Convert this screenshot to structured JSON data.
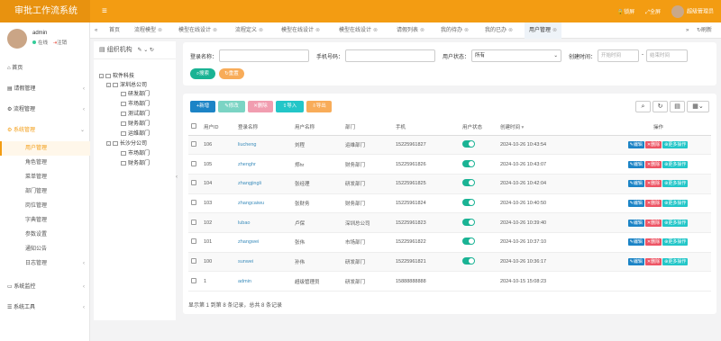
{
  "app": {
    "title": "审批工作流系统",
    "menu_icon": "hamburger-icon"
  },
  "top_right": {
    "lock": "锁屏",
    "fullscreen": "全屏",
    "user": "超级管理员"
  },
  "sidebar": {
    "user_name": "admin",
    "status_online": "在线",
    "logout": "注销",
    "items": [
      {
        "label": "首页",
        "icon": "home-icon"
      },
      {
        "label": "请假管理",
        "icon": "calendar-icon"
      },
      {
        "label": "流程管理",
        "icon": "flow-icon"
      },
      {
        "label": "系统管理",
        "icon": "gear-icon"
      }
    ],
    "subitems": [
      "用户管理",
      "角色管理",
      "菜单管理",
      "部门管理",
      "岗位管理",
      "字典管理",
      "参数设置",
      "通知公告",
      "日志管理"
    ],
    "bottom_items": [
      {
        "label": "系统监控",
        "icon": "monitor-icon"
      },
      {
        "label": "系统工具",
        "icon": "tool-icon"
      }
    ]
  },
  "tabs": {
    "items": [
      "首页",
      "流程模型",
      "模型在线设计",
      "流程定义",
      "模型在线设计",
      "模型在线设计",
      "请假列表",
      "我的待办",
      "我的已办",
      "用户管理"
    ],
    "refresh": "刷新"
  },
  "tree": {
    "header": "组织机构",
    "nodes": [
      "软件科技",
      "深圳总公司",
      "研发部门",
      "市场部门",
      "测试部门",
      "财务部门",
      "运维部门",
      "长沙分公司",
      "市场部门",
      "财务部门"
    ]
  },
  "search": {
    "login_name_label": "登录名称：",
    "phone_label": "手机号码：",
    "status_label": "用户状态：",
    "status_value": "所有",
    "created_label": "创建时间：",
    "start_placeholder": "开始时间",
    "end_placeholder": "结束时间",
    "search_btn": "搜索",
    "reset_btn": "重置"
  },
  "toolbar": {
    "add": "新增",
    "edit": "修改",
    "delete": "删除",
    "import": "导入",
    "export": "导出"
  },
  "table": {
    "headers": [
      "用户ID",
      "登录名称",
      "用户名称",
      "部门",
      "手机",
      "用户状态",
      "创建时间",
      "操作"
    ],
    "rows": [
      {
        "id": "106",
        "login": "liucheng",
        "name": "刘程",
        "dept": "运维部门",
        "phone": "15225961827",
        "time": "2024-10-26 10:43:54"
      },
      {
        "id": "105",
        "login": "zhenghr",
        "name": "郑hr",
        "dept": "财务部门",
        "phone": "15225961826",
        "time": "2024-10-26 10:43:07"
      },
      {
        "id": "104",
        "login": "zhangjingli",
        "name": "张经理",
        "dept": "研发部门",
        "phone": "15225961825",
        "time": "2024-10-26 10:42:04"
      },
      {
        "id": "103",
        "login": "zhangcaiwu",
        "name": "张财务",
        "dept": "财务部门",
        "phone": "15225961824",
        "time": "2024-10-26 10:40:50"
      },
      {
        "id": "102",
        "login": "lubao",
        "name": "卢保",
        "dept": "深圳总公司",
        "phone": "15225961823",
        "time": "2024-10-26 10:39:40"
      },
      {
        "id": "101",
        "login": "zhangwei",
        "name": "张伟",
        "dept": "市场部门",
        "phone": "15225961822",
        "time": "2024-10-26 10:37:10"
      },
      {
        "id": "100",
        "login": "sunwei",
        "name": "孙伟",
        "dept": "研发部门",
        "phone": "15225961821",
        "time": "2024-10-26 10:36:17"
      },
      {
        "id": "1",
        "login": "admin",
        "name": "超级管理员",
        "dept": "研发部门",
        "phone": "15888888888",
        "time": "2024-10-15 15:08:23"
      }
    ],
    "op_edit": "编辑",
    "op_delete": "删除",
    "op_more": "更多操作",
    "footer": "显示第 1 到第 8 条记录，总共 8 条记录"
  }
}
